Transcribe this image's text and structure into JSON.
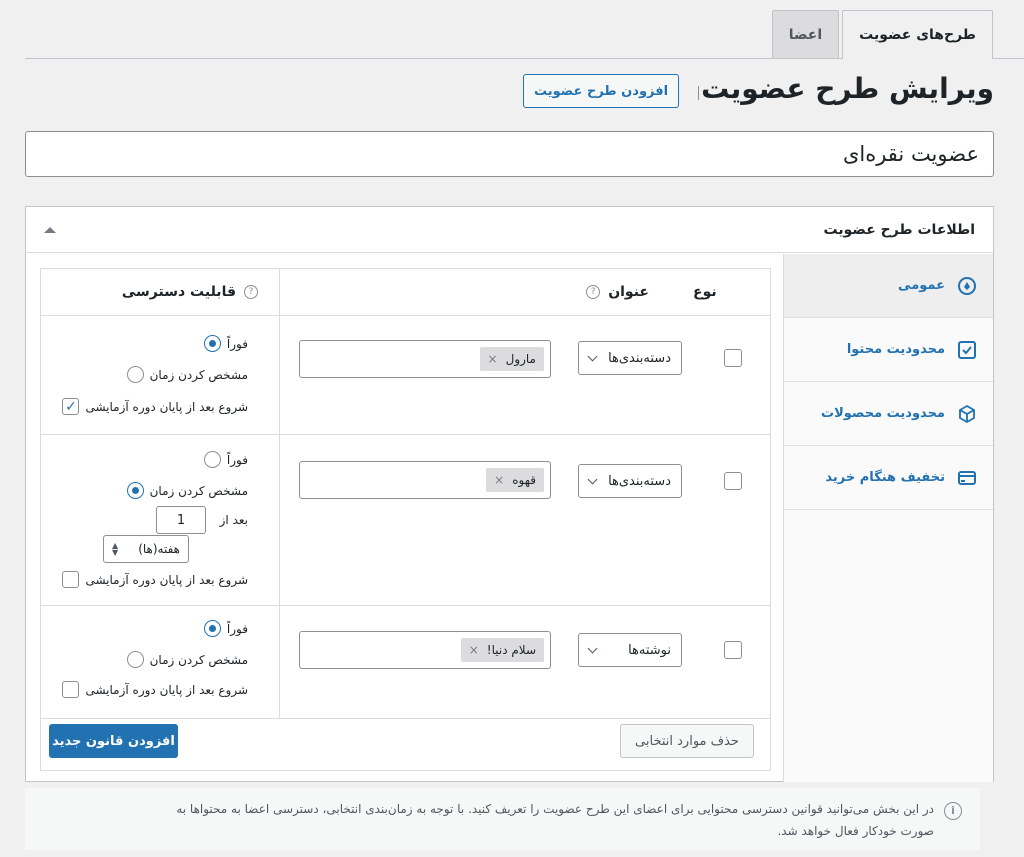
{
  "tabs": [
    {
      "label": "اعضا"
    },
    {
      "label": "طرح‌های عضویت"
    }
  ],
  "header": {
    "title": "ویرایش طرح عضویت",
    "add_plan_button": "افزودن طرح عضویت"
  },
  "plan_name": "عضویت نقره‌ای",
  "panel": {
    "title": "اطلاعات طرح عضویت"
  },
  "sidebar": {
    "items": [
      {
        "label": "عمومی",
        "icon": "general-icon"
      },
      {
        "label": "محدودیت محتوا",
        "icon": "checkbox-icon"
      },
      {
        "label": "محدودیت محصولات",
        "icon": "cube-icon"
      },
      {
        "label": "تخفیف هنگام خرید",
        "icon": "credit-card-icon"
      }
    ]
  },
  "table": {
    "headers": {
      "type": "نوع",
      "title": "عنوان",
      "access": "قابلیت دسترسی"
    },
    "rows": [
      {
        "type_select": "دسته‌بندی‌ها",
        "tag": "مارول",
        "opt_immediate": "فوراً",
        "opt_schedule": "مشخص کردن زمان",
        "opt_trial": "شروع بعد از پایان دوره آزمایشی"
      },
      {
        "type_select": "دسته‌بندی‌ها",
        "tag": "قهوه",
        "opt_immediate": "فوراً",
        "opt_schedule": "مشخص کردن زمان",
        "after_label": "بعد از",
        "after_value": "1",
        "unit": "هفته(ها)",
        "opt_trial": "شروع بعد از پایان دوره آزمایشی"
      },
      {
        "type_select": "نوشته‌ها",
        "tag": "سلام دنیا!",
        "opt_immediate": "فوراً",
        "opt_schedule": "مشخص کردن زمان",
        "opt_trial": "شروع بعد از پایان دوره آزمایشی"
      }
    ],
    "delete_button": "حذف موارد انتخابی",
    "add_rule_button": "افزودن قانون جدید"
  },
  "note": {
    "line1": "در این بخش می‌توانید قوانین دسترسی محتوایی برای اعضای این طرح عضویت را تعریف کنید. با توجه به زمان‌بندی انتخابی، دسترسی اعضا به محتواها به",
    "line2": "صورت خودکار فعال خواهد شد."
  },
  "colors": {
    "accent": "#2271b1",
    "background": "#f0f0f1",
    "border": "#c3c4c7"
  }
}
